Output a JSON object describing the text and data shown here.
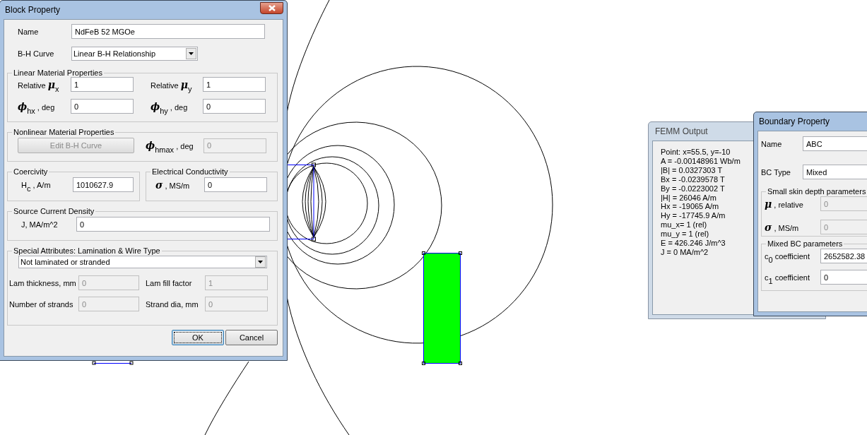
{
  "block_property": {
    "title": "Block Property",
    "name": {
      "label": "Name",
      "value": "NdFeB 52 MGOe"
    },
    "bh_curve": {
      "label": "B-H Curve",
      "value": "Linear B-H Relationship"
    },
    "linear": {
      "title": "Linear Material Properties",
      "fields": [
        {
          "label": "Relative **μ**$_{x}$",
          "value": "1",
          "disabled": false
        },
        {
          "label": "Relative **μ**$_{y}$",
          "value": "1",
          "disabled": false
        },
        {
          "label": "**ϕ**$_{hx}$ , deg",
          "value": "0",
          "disabled": false
        },
        {
          "label": "**ϕ**$_{hy}$ , deg",
          "value": "0",
          "disabled": false
        }
      ]
    },
    "nonlinear": {
      "title": "Nonlinear Material Properties",
      "button": {
        "label": "Edit B-H Curve",
        "disabled": true
      },
      "field": {
        "label": "**ϕ**$_{hmax}$ , deg",
        "value": "0",
        "disabled": true
      }
    },
    "coercivity": {
      "title": "Coercivity",
      "field": {
        "label": "H$_{c}$ , A/m",
        "value": "1010627.9",
        "disabled": false
      }
    },
    "conductivity": {
      "title": "Electrical Conductivity",
      "field": {
        "label": "**σ** , MS/m",
        "value": "0",
        "disabled": false
      }
    },
    "source": {
      "title": "Source Current Density",
      "field": {
        "label": "J, MA/m^2",
        "value": "0",
        "disabled": false
      }
    },
    "special": {
      "title": "Special Attributes: Lamination & Wire Type",
      "dropdown": {
        "value": "Not laminated or stranded"
      },
      "fields": [
        {
          "label": "Lam thickness, mm",
          "value": "0",
          "disabled": true
        },
        {
          "label": "Lam fill factor",
          "value": "1",
          "disabled": true
        },
        {
          "label": "Number of strands",
          "value": "0",
          "disabled": true
        },
        {
          "label": "Strand dia, mm",
          "value": "0",
          "disabled": true
        }
      ]
    },
    "buttons": [
      {
        "label": "OK",
        "default": true
      },
      {
        "label": "Cancel",
        "default": false
      }
    ]
  },
  "femm_output": {
    "title": "FEMM Output",
    "lines": [
      "Point: x=55.5, y=-10",
      "A = -0.00148961 Wb/m",
      "|B| = 0.0327303 T",
      "Bx = -0.0239578 T",
      "By = -0.0223002 T",
      "|H| = 26046 A/m",
      "Hx = -19065 A/m",
      "Hy = -17745.9 A/m",
      "mu_x= 1 (rel)",
      "mu_y = 1 (rel)",
      "E = 426.246 J/m^3",
      "J = 0 MA/m^2"
    ]
  },
  "boundary_property": {
    "title": "Boundary Property",
    "name": {
      "label": "Name",
      "value": "ABC"
    },
    "bc_type": {
      "label": "BC Type",
      "value": "Mixed"
    },
    "skin": {
      "title": "Small skin depth parameters",
      "fields": [
        {
          "label": "**μ** , relative",
          "value": "0",
          "disabled": true
        },
        {
          "label": "**σ** , MS/m",
          "value": "0",
          "disabled": true
        }
      ]
    },
    "mixed": {
      "title": "Mixed BC parameters",
      "fields": [
        {
          "label": "c$_{0}$ coefficient",
          "value": "2652582.38",
          "disabled": false
        },
        {
          "label": "c$_{1}$ coefficient",
          "value": "0",
          "disabled": false
        }
      ]
    }
  }
}
